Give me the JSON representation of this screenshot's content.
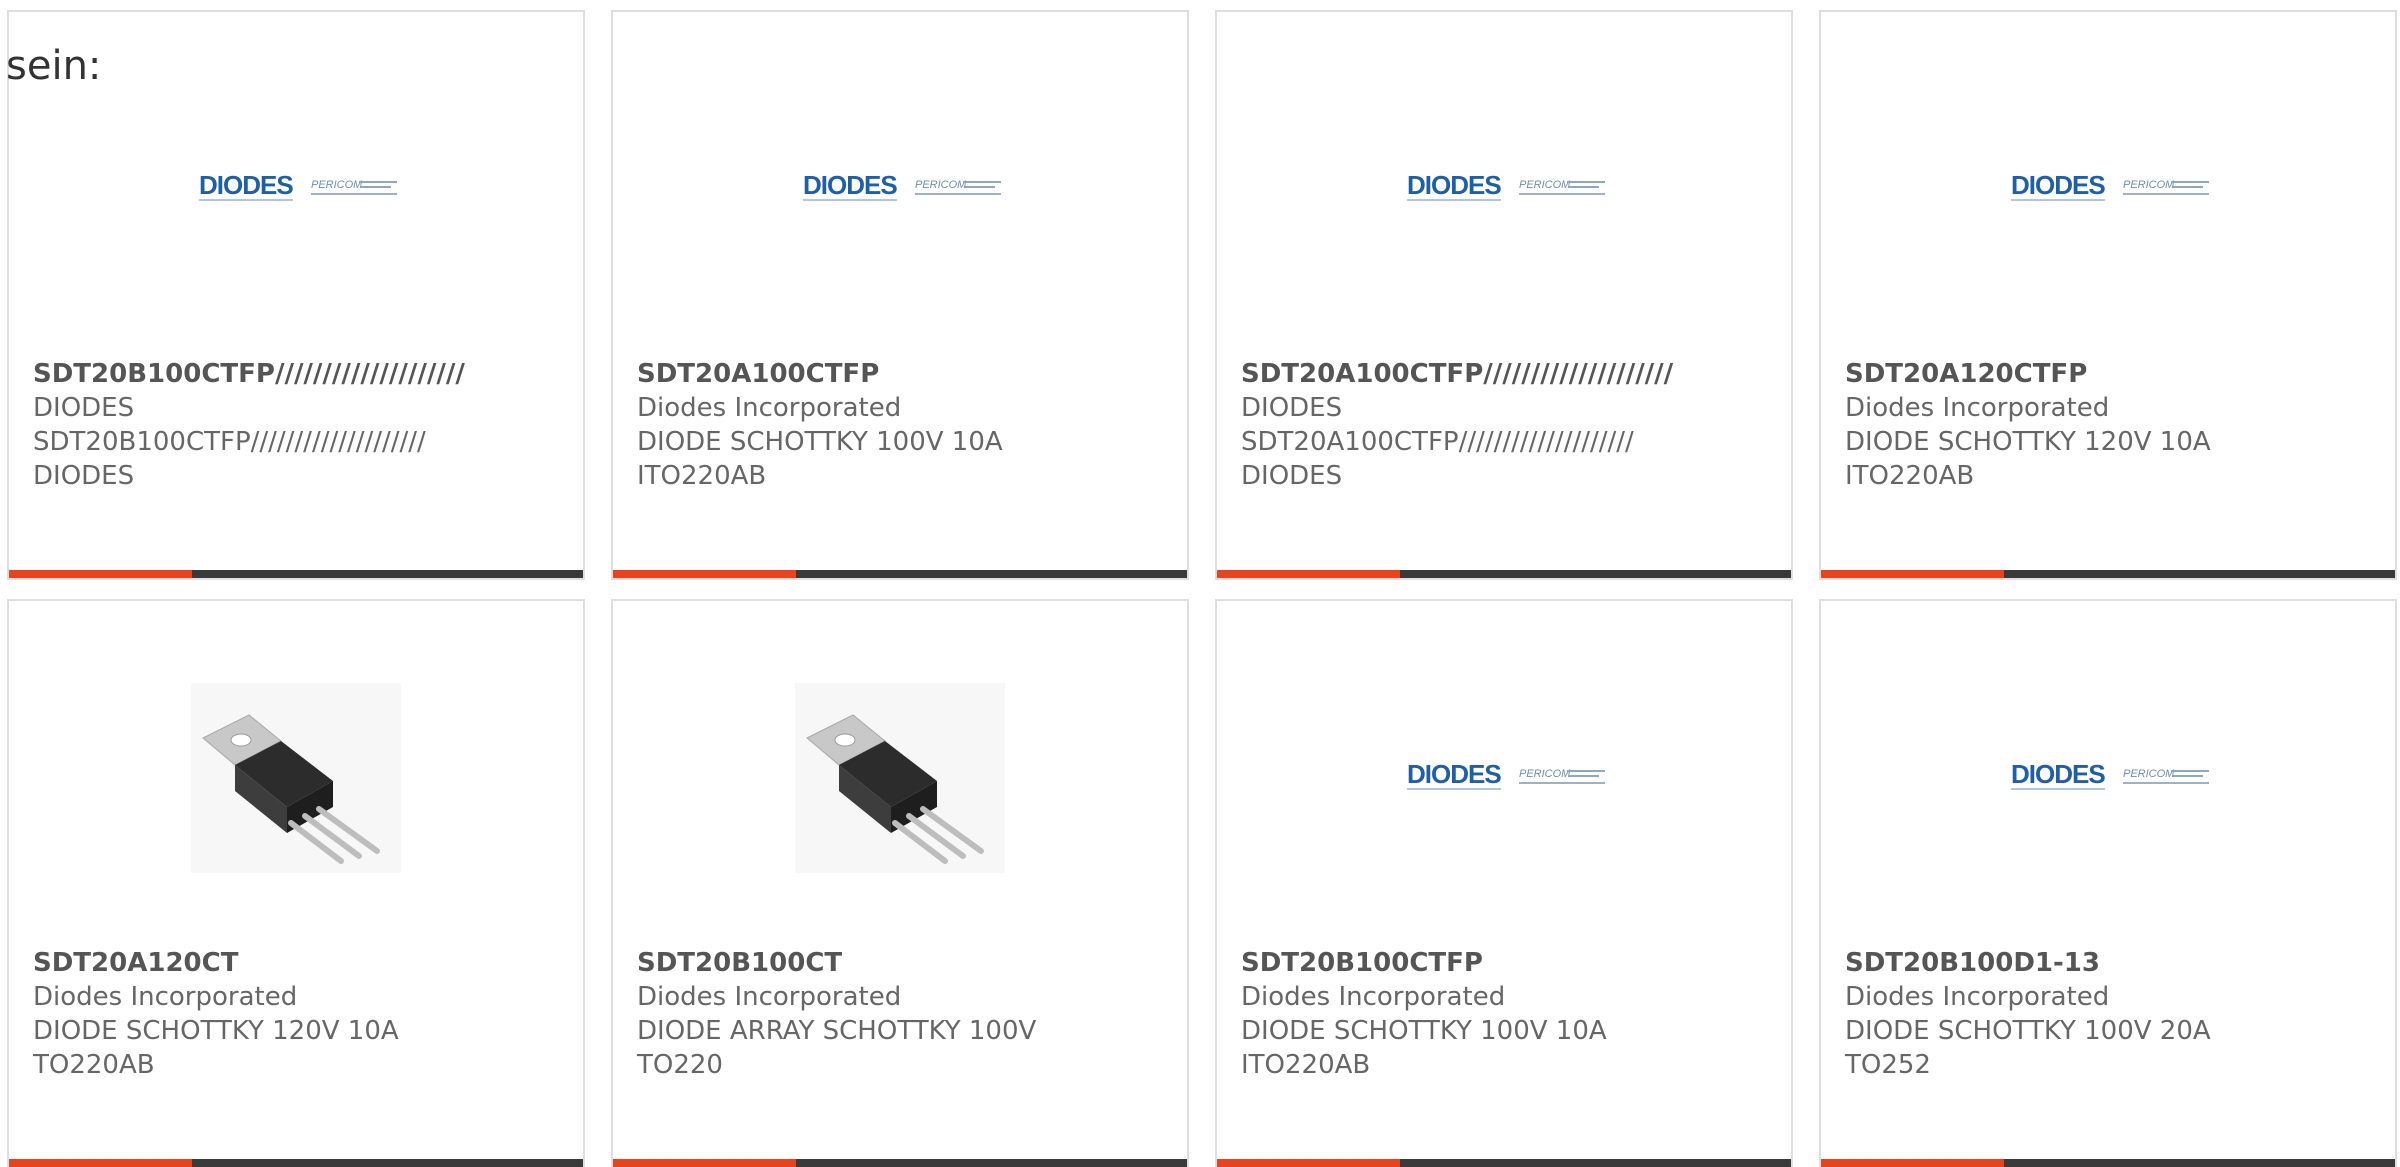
{
  "intro": "sein:",
  "brand_colors": {
    "accent": "#e8431f",
    "bar": "#3a3a3a",
    "diodes_blue": "#1f5fa8",
    "pericom_gray": "#8ca8c4"
  },
  "logo": {
    "diodes_text": "DIODES",
    "pericom_text": "PERICOM"
  },
  "cards": [
    {
      "image": "diodes-pericom-logo",
      "title": "SDT20B100CTFP////////////////////",
      "line1": "DIODES",
      "line2": "SDT20B100CTFP////////////////////",
      "line3": "DIODES"
    },
    {
      "image": "diodes-pericom-logo",
      "title": "SDT20A100CTFP",
      "line1": "Diodes Incorporated",
      "line2": "DIODE SCHOTTKY 100V 10A",
      "line3": "ITO220AB"
    },
    {
      "image": "diodes-pericom-logo",
      "title": "SDT20A100CTFP////////////////////",
      "line1": "DIODES",
      "line2": "SDT20A100CTFP////////////////////",
      "line3": "DIODES"
    },
    {
      "image": "diodes-pericom-logo",
      "title": "SDT20A120CTFP",
      "line1": "Diodes Incorporated",
      "line2": "DIODE SCHOTTKY 120V 10A",
      "line3": "ITO220AB"
    },
    {
      "image": "to220-package-photo",
      "title": "SDT20A120CT",
      "line1": "Diodes Incorporated",
      "line2": "DIODE SCHOTTKY 120V 10A",
      "line3": "TO220AB"
    },
    {
      "image": "to220-package-photo",
      "title": "SDT20B100CT",
      "line1": "Diodes Incorporated",
      "line2": "DIODE ARRAY SCHOTTKY 100V",
      "line3": "TO220"
    },
    {
      "image": "diodes-pericom-logo",
      "title": "SDT20B100CTFP",
      "line1": "Diodes Incorporated",
      "line2": "DIODE SCHOTTKY 100V 10A",
      "line3": "ITO220AB"
    },
    {
      "image": "diodes-pericom-logo",
      "title": "SDT20B100D1-13",
      "line1": "Diodes Incorporated",
      "line2": "DIODE SCHOTTKY 100V 20A",
      "line3": "TO252"
    }
  ]
}
